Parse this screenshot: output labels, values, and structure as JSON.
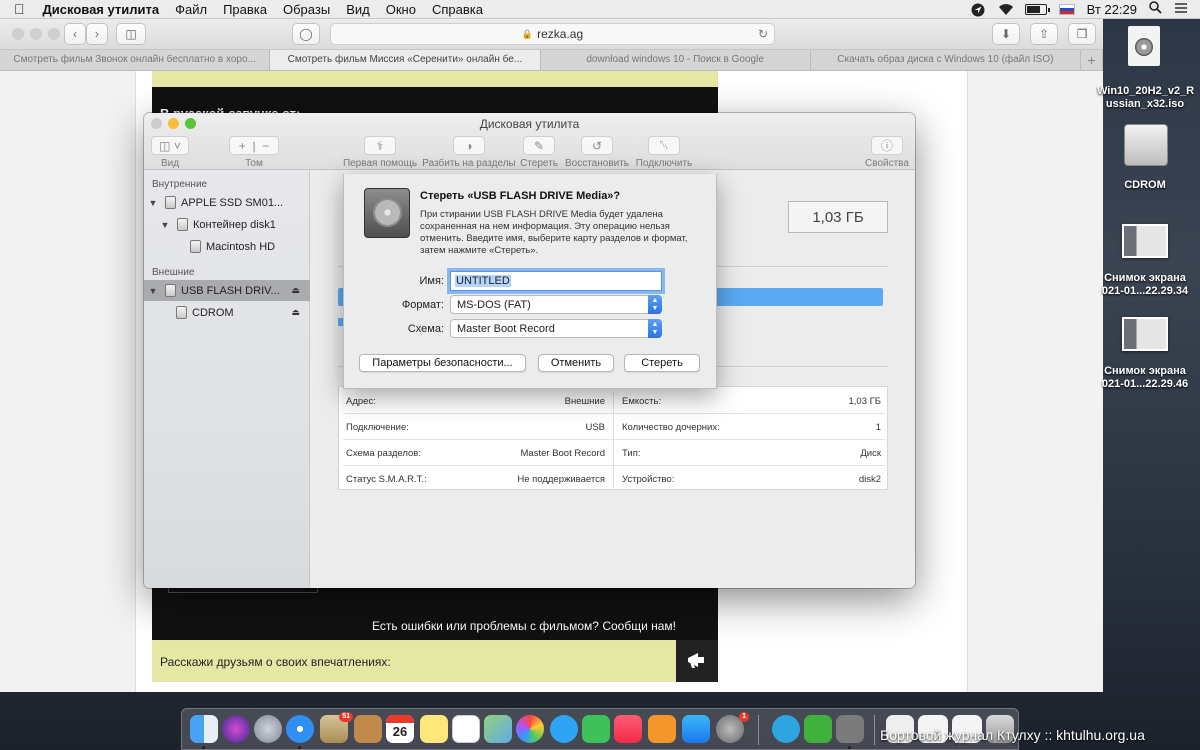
{
  "menubar": {
    "app_name": "Дисковая утилита",
    "items": [
      "Файл",
      "Правка",
      "Образы",
      "Вид",
      "Окно",
      "Справка"
    ],
    "clock": "Вт 22:29"
  },
  "browser": {
    "url": "rezka.ag",
    "tabs": [
      "Смотреть фильм Звонок онлайн бесплатно в хоро...",
      "Смотреть фильм Миссия «Серенити» онлайн бе...",
      "download windows 10 - Поиск в Google",
      "Скачать образ диска с Windows 10 (файл ISO)"
    ],
    "page": {
      "dub_heading": "В русской озвучке от:",
      "report_text": "Есть ошибки или проблемы с фильмом? Сообщи нам!",
      "share_text": "Расскажи друзьям о своих впечатлениях:"
    }
  },
  "disk_utility": {
    "title": "Дисковая утилита",
    "toolbar": {
      "view": "Вид",
      "volume": "Том",
      "first_aid": "Первая помощь",
      "partition": "Разбить на разделы",
      "erase": "Стереть",
      "restore": "Восстановить",
      "mount": "Подключить",
      "info": "Свойства"
    },
    "sidebar": {
      "internal_header": "Внутренние",
      "external_header": "Внешние",
      "internal": [
        "APPLE SSD SM01...",
        "Контейнер disk1",
        "Macintosh HD"
      ],
      "external": [
        "USB FLASH DRIV...",
        "CDROM"
      ]
    },
    "capacity_display": "1,03 ГБ",
    "info": {
      "left": [
        {
          "label": "Адрес:",
          "value": "Внешние"
        },
        {
          "label": "Подключение:",
          "value": "USB"
        },
        {
          "label": "Схема разделов:",
          "value": "Master Boot Record"
        },
        {
          "label": "Статус S.M.A.R.T.:",
          "value": "Не поддерживается"
        }
      ],
      "right": [
        {
          "label": "Емкость:",
          "value": "1,03 ГБ"
        },
        {
          "label": "Количество дочерних:",
          "value": "1"
        },
        {
          "label": "Тип:",
          "value": "Диск"
        },
        {
          "label": "Устройство:",
          "value": "disk2"
        }
      ]
    }
  },
  "erase_sheet": {
    "title": "Стереть «USB FLASH DRIVE Media»?",
    "description": "При стирании USB FLASH DRIVE Media будет удалена сохраненная на нем информация. Эту операцию нельзя отменить. Введите имя, выберите карту разделов и формат, затем нажмите «Стереть».",
    "name_label": "Имя:",
    "name_value": "UNTITLED",
    "format_label": "Формат:",
    "format_value": "MS-DOS (FAT)",
    "scheme_label": "Схема:",
    "scheme_value": "Master Boot Record",
    "security_button": "Параметры безопасности...",
    "cancel_button": "Отменить",
    "erase_button": "Стереть"
  },
  "desktop": {
    "icons": [
      {
        "label": "Win10_20H2_v2_R ussian_x32.iso"
      },
      {
        "label": "CDROM"
      },
      {
        "label": "Снимок экрана 021-01...22.29.34"
      },
      {
        "label": "Снимок экрана 021-01...22.29.46"
      }
    ]
  },
  "dock": {
    "calendar_day": "26",
    "mail_badge": "51",
    "prefs_badge": "1"
  },
  "watermark": "Бортовой журнал Ктулху :: khtulhu.org.ua",
  "colors": {
    "accent": "#2b72e0",
    "selection": "#a9abae",
    "usage_bar": "#5aa9f2",
    "page_yellow": "#e5e8a5"
  }
}
